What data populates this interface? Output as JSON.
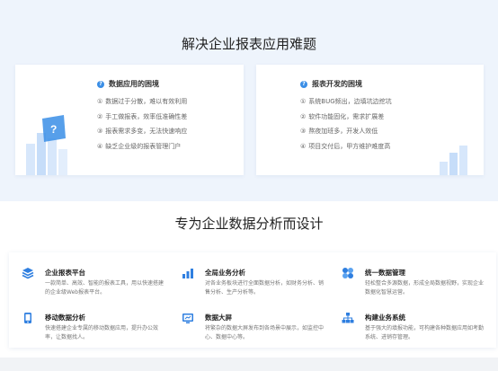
{
  "problems": {
    "title": "解决企业报表应用难题",
    "cards": [
      {
        "badge": "?",
        "heading": "数据应用的困境",
        "points": [
          {
            "n": "①",
            "text": "数据过于分散，难以有效利用"
          },
          {
            "n": "②",
            "text": "手工做报表，效率低准确性差"
          },
          {
            "n": "③",
            "text": "报表需求多变，无法快速响应"
          },
          {
            "n": "④",
            "text": "缺乏企业级的报表管理门户"
          }
        ]
      },
      {
        "badge": "?",
        "heading": "报表开发的困境",
        "points": [
          {
            "n": "①",
            "text": "系统BUG频出，边填坑边挖坑"
          },
          {
            "n": "②",
            "text": "软件功能固化，需求扩展差"
          },
          {
            "n": "③",
            "text": "熬夜加班多，开发人效低"
          },
          {
            "n": "④",
            "text": "项目交付后，甲方维护难度高"
          }
        ]
      }
    ]
  },
  "design": {
    "title": "专为企业数据分析而设计",
    "features": [
      {
        "icon": "layers-icon",
        "title": "企业报表平台",
        "desc": "一款简单、高效、智能的报表工具，用以快速搭建的企业级Web报表平台。"
      },
      {
        "icon": "bar-chart-icon",
        "title": "全局业务分析",
        "desc": "对各业务板块进行全面数据分析，如财务分析、销售分析、生产分析等。"
      },
      {
        "icon": "pinwheel-icon",
        "title": "统一数据管理",
        "desc": "轻松整合多源数据，形成全局数据视野，实现企业数据化智慧运营。"
      },
      {
        "icon": "mobile-icon",
        "title": "移动数据分析",
        "desc": "快速搭建企业专属的移动数据应用，提升办公效率，让数据找人。"
      },
      {
        "icon": "monitor-icon",
        "title": "数据大屏",
        "desc": "将繁杂的数据大屏发布到各场景中展示，如监控中心、数据中心等。"
      },
      {
        "icon": "hierarchy-icon",
        "title": "构建业务系统",
        "desc": "基于强大的填报功能，可构建各种数据应用如考勤系统、进销存管理。"
      }
    ]
  },
  "colors": {
    "accent": "#3a8ee6",
    "band": "#eef4fc"
  }
}
